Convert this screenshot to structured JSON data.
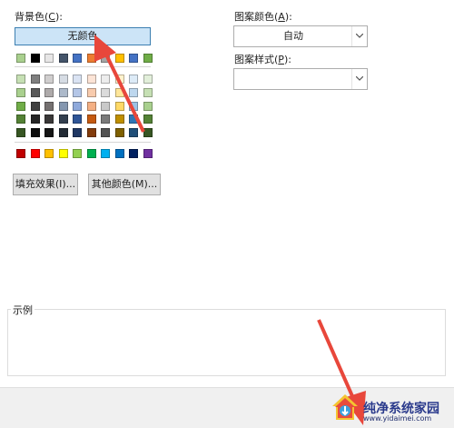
{
  "background_color": {
    "label": "背景色",
    "accelerator": "C",
    "no_color_button": "无颜色",
    "swatch_rows": [
      [
        "#a9d08e",
        "#000000",
        "#e7e6e6",
        "#44546a",
        "#4472c4",
        "#ed7d31",
        "#a5a5a5",
        "#ffc000",
        "#4472c4",
        "#70ad47"
      ],
      [
        "#c6e0b4",
        "#7f7f7f",
        "#d0cece",
        "#d6dce4",
        "#dae3f3",
        "#fce4d6",
        "#ededed",
        "#fff2cc",
        "#ddebf7",
        "#e2efda"
      ],
      [
        "#a9d08e",
        "#595959",
        "#aeaaaa",
        "#acb9ca",
        "#b4c6e7",
        "#f8cbad",
        "#dbdbdb",
        "#ffe699",
        "#bdd7ee",
        "#c6e0b4"
      ],
      [
        "#70ad47",
        "#404040",
        "#757171",
        "#8497b0",
        "#8ea9db",
        "#f4b084",
        "#c9c9c9",
        "#ffd966",
        "#9bc2e6",
        "#a9d08e"
      ],
      [
        "#548235",
        "#262626",
        "#3a3838",
        "#333f4f",
        "#2f5597",
        "#c55a11",
        "#7b7b7b",
        "#bf8f00",
        "#2f75b5",
        "#548235"
      ],
      [
        "#375623",
        "#0d0d0d",
        "#161616",
        "#222b35",
        "#203864",
        "#833c0c",
        "#525252",
        "#7f6000",
        "#1f4e78",
        "#375623"
      ],
      [
        "#c00000",
        "#ff0000",
        "#ffc000",
        "#ffff00",
        "#92d050",
        "#00b050",
        "#00b0f0",
        "#0070c0",
        "#002060",
        "#7030a0"
      ]
    ]
  },
  "buttons": {
    "fill_effects": "填充效果(I)...",
    "more_colors": "其他颜色(M)..."
  },
  "pattern_color": {
    "label": "图案颜色",
    "accelerator": "A",
    "value": "自动"
  },
  "pattern_style": {
    "label": "图案样式",
    "accelerator": "P",
    "value": ""
  },
  "sample": {
    "label": "示例"
  },
  "watermark": {
    "title": "纯净系统家园",
    "url": "www.yidaimei.com"
  },
  "annotation_color": "#e8473b"
}
